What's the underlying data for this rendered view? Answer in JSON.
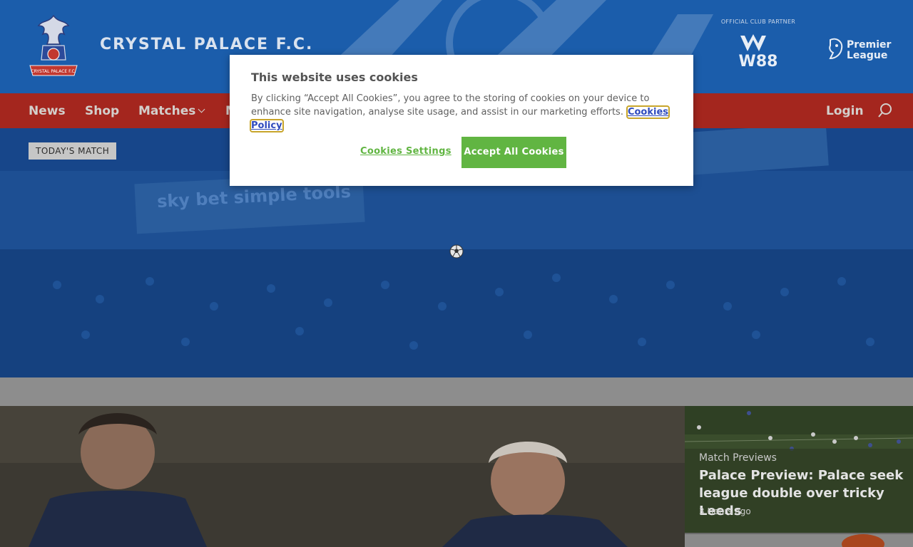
{
  "header": {
    "club_name": "CRYSTAL PALACE F.C.",
    "partner_label": "OFFICIAL CLUB PARTNER",
    "partner_name": "W88",
    "league_name_line1": "Premier",
    "league_name_line2": "League",
    "crest_text": "CRYSTAL PALACE F.C."
  },
  "nav": {
    "items": [
      {
        "label": "News"
      },
      {
        "label": "Shop"
      },
      {
        "label": "Matches"
      },
      {
        "label": "M"
      }
    ],
    "login_label": "Login",
    "search_icon": "search-icon"
  },
  "hero": {
    "badge": "TODAY'S MATCH",
    "banner_text": "sky bet simple tools"
  },
  "feature_card": {
    "category": "Match Previews",
    "title": "Palace Preview: Palace seek league double over tricky Leeds",
    "time": "3 Hours ago"
  },
  "cookie_dialog": {
    "title": "This website uses cookies",
    "body": "By clicking “Accept All Cookies”, you agree to the storing of cookies on your device to enhance site navigation, analyse site usage, and assist in our marketing efforts.",
    "policy_link": "Cookies Policy",
    "settings_button": "Cookies Settings",
    "accept_button": "Accept All Cookies"
  },
  "colors": {
    "header_blue": "#1b5dab",
    "nav_red": "#a4261e",
    "accept_green": "#61b542"
  }
}
